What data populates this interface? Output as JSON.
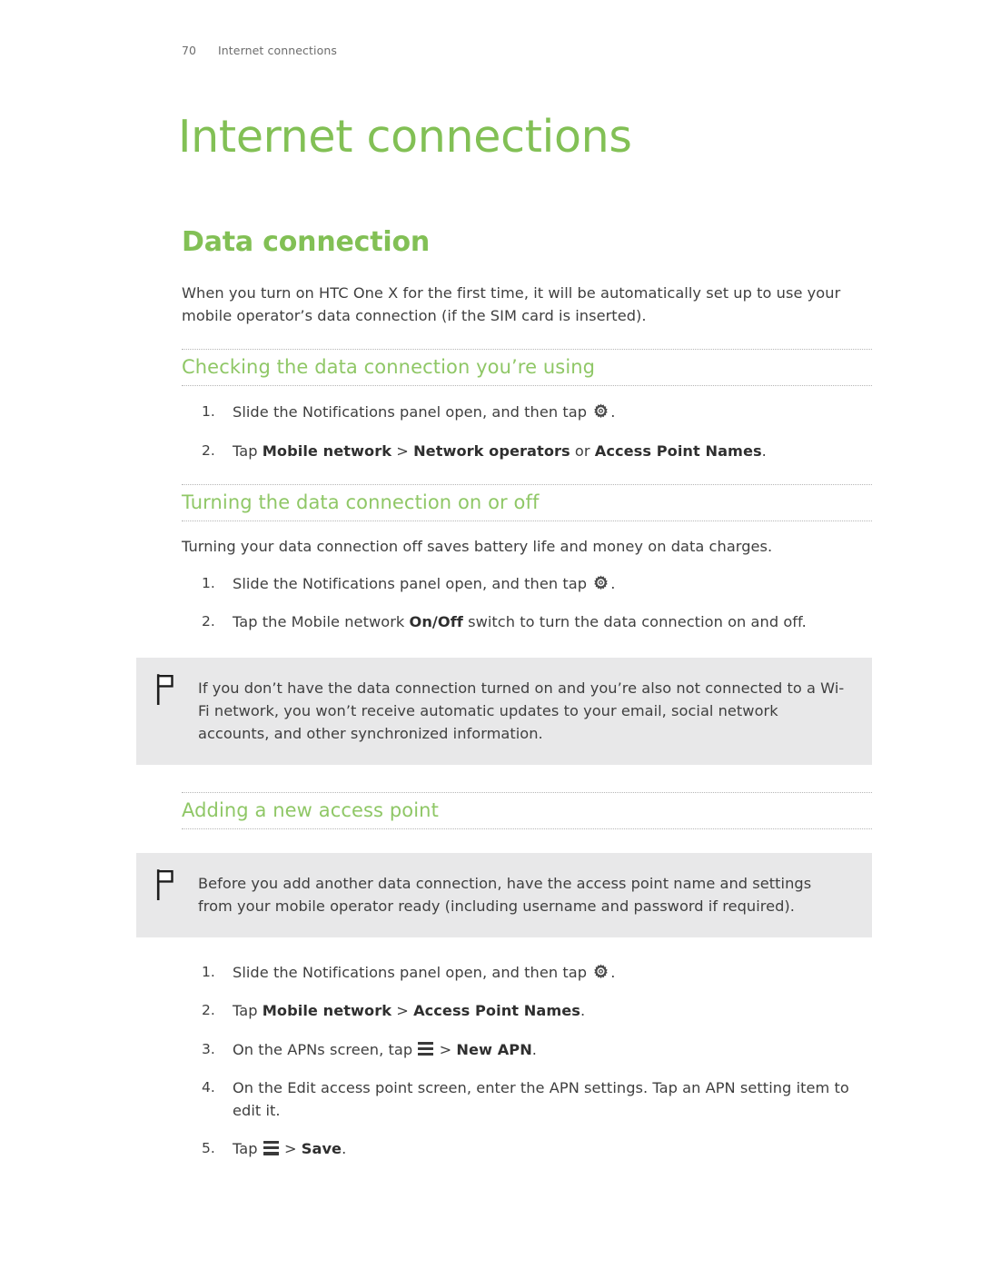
{
  "header": {
    "page_number": "70",
    "running_title": "Internet connections"
  },
  "chapter": {
    "title": "Internet connections"
  },
  "colors": {
    "heading_green": "#82c055",
    "subheading_green": "#8fc766",
    "callout_background": "#e8e8e9",
    "body_text": "#3f3f3f"
  },
  "section": {
    "heading": "Data connection",
    "intro": "When you turn on HTC One X for the first time, it will be automatically set up to use your mobile operator’s data connection (if the SIM card is inserted)."
  },
  "sub1": {
    "heading": "Checking the data connection you’re using",
    "steps": [
      {
        "num": "1.",
        "pre": "Slide the Notifications panel open, and then tap ",
        "icon": "gear-icon",
        "post": "."
      },
      {
        "num": "2.",
        "a": "Tap ",
        "b_bold": "Mobile network",
        "c": " > ",
        "d_bold": "Network operators",
        "e": " or ",
        "f_bold": "Access Point Names",
        "g": "."
      }
    ]
  },
  "sub2": {
    "heading": "Turning the data connection on or off",
    "intro": "Turning your data connection off saves battery life and money on data charges.",
    "steps": [
      {
        "num": "1.",
        "pre": "Slide the Notifications panel open, and then tap ",
        "icon": "gear-icon",
        "post": "."
      },
      {
        "num": "2.",
        "a": "Tap the Mobile network ",
        "b_bold": "On/Off",
        "c": " switch to turn the data connection on and off."
      }
    ],
    "note": {
      "icon": "flag-icon",
      "text": "If you don’t have the data connection turned on and you’re also not connected to a Wi-Fi network, you won’t receive automatic updates to your email, social network accounts, and other synchronized information."
    }
  },
  "sub3": {
    "heading": "Adding a new access point",
    "note": {
      "icon": "flag-icon",
      "text": "Before you add another data connection, have the access point name and settings from your mobile operator ready (including username and password if required)."
    },
    "steps": [
      {
        "num": "1.",
        "pre": "Slide the Notifications panel open, and then tap ",
        "icon": "gear-icon",
        "post": "."
      },
      {
        "num": "2.",
        "a": "Tap ",
        "b_bold": "Mobile network",
        "c": " > ",
        "d_bold": "Access Point Names",
        "e": "."
      },
      {
        "num": "3.",
        "a": "On the APNs screen, tap ",
        "icon": "menu-icon",
        "c": " > ",
        "d_bold": "New APN",
        "e": "."
      },
      {
        "num": "4.",
        "a": "On the Edit access point screen, enter the APN settings. Tap an APN setting item to edit it."
      },
      {
        "num": "5.",
        "a": "Tap ",
        "icon": "menu-icon",
        "c": " > ",
        "d_bold": "Save",
        "e": "."
      }
    ]
  }
}
